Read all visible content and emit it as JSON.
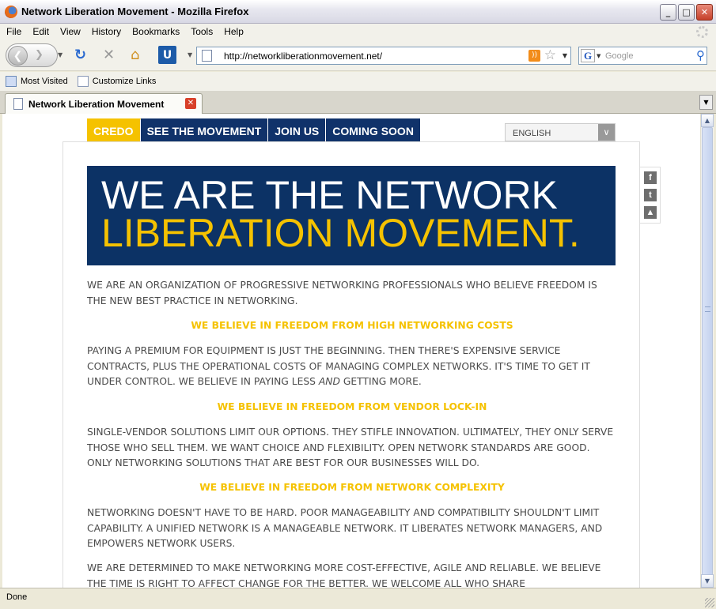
{
  "window": {
    "title": "Network Liberation Movement - Mozilla Firefox",
    "minimize": "_",
    "maximize": "□",
    "close": "✕"
  },
  "menu": [
    "File",
    "Edit",
    "View",
    "History",
    "Bookmarks",
    "Tools",
    "Help"
  ],
  "toolbar": {
    "url": "http://networkliberationmovement.net/",
    "search_placeholder": "Google",
    "search_engine_glyph": "G"
  },
  "bookmarks": [
    "Most Visited",
    "Customize Links"
  ],
  "tab": {
    "label": "Network Liberation Movement"
  },
  "site": {
    "nav": [
      "CREDO",
      "SEE THE MOVEMENT",
      "JOIN US",
      "COMING SOON"
    ],
    "active_nav": "CREDO",
    "language": "ENGLISH",
    "social_icons": [
      "facebook-icon",
      "twitter-icon",
      "pdf-icon"
    ],
    "hero_line1": "WE ARE THE NETWORK",
    "hero_line2": "LIBERATION MOVEMENT.",
    "intro": "WE ARE AN ORGANIZATION OF PROGRESSIVE NETWORKING PROFESSIONALS WHO BELIEVE FREEDOM IS THE NEW BEST PRACTICE IN NETWORKING.",
    "heading1": "WE BELIEVE IN FREEDOM FROM HIGH NETWORKING COSTS",
    "para1_before": "PAYING A PREMIUM FOR EQUIPMENT IS JUST THE BEGINNING. THEN THERE'S EXPENSIVE SERVICE CONTRACTS, PLUS THE OPERATIONAL COSTS OF MANAGING COMPLEX NETWORKS. IT'S TIME TO GET IT UNDER CONTROL. WE BELIEVE IN PAYING LESS ",
    "para1_em": "AND",
    "para1_after": " GETTING MORE.",
    "heading2": "WE BELIEVE IN FREEDOM FROM VENDOR LOCK-IN",
    "para2": "SINGLE-VENDOR SOLUTIONS LIMIT OUR OPTIONS. THEY STIFLE INNOVATION. ULTIMATELY, THEY ONLY SERVE THOSE WHO SELL THEM. WE WANT CHOICE AND FLEXIBILITY. OPEN NETWORK STANDARDS ARE GOOD. ONLY NETWORKING SOLUTIONS THAT ARE BEST FOR OUR BUSINESSES WILL DO.",
    "heading3": "WE BELIEVE IN FREEDOM FROM NETWORK COMPLEXITY",
    "para3": "NETWORKING DOESN'T HAVE TO BE HARD. POOR MANAGEABILITY AND COMPATIBILITY SHOULDN'T LIMIT CAPABILITY. A UNIFIED NETWORK IS A MANAGEABLE NETWORK. IT LIBERATES NETWORK MANAGERS, AND EMPOWERS NETWORK USERS.",
    "para4": "WE ARE DETERMINED TO MAKE NETWORKING MORE COST-EFFECTIVE, AGILE AND RELIABLE. WE BELIEVE THE TIME IS RIGHT TO AFFECT CHANGE FOR THE BETTER. WE WELCOME ALL WHO SHARE"
  },
  "status": "Done",
  "colors": {
    "navy": "#0c3265",
    "gold": "#f5c200",
    "body_text": "#4a4a4a"
  }
}
